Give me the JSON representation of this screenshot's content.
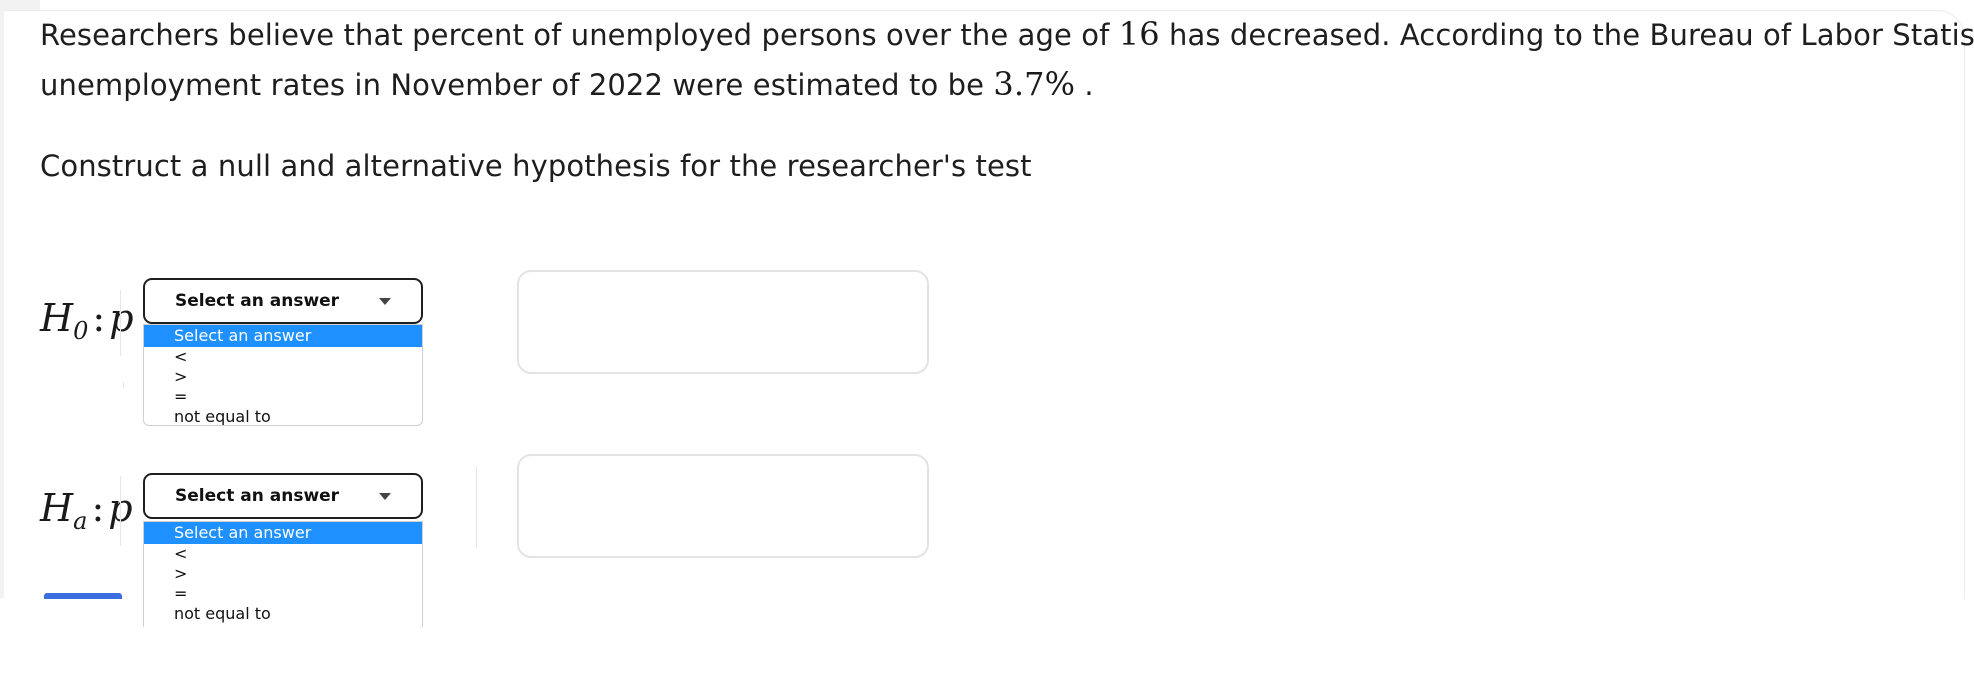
{
  "question": {
    "line1_a": "Researchers believe that percent of unemployed persons over the age of ",
    "line1_age": "16",
    "line1_b": " has decreased. According to the Bureau of Labor Statistics,",
    "line2_a": "unemployment rates in November of 2022 were estimated to be ",
    "line2_rate": "3.7",
    "line2_pct": "%",
    "line2_end": " .",
    "instruction": "Construct a null and alternative hypothesis for the researcher's test"
  },
  "null_hypothesis": {
    "H": "H",
    "sub": "0",
    "colon": ":",
    "p": "p",
    "select_label": "Select an answer",
    "options": [
      "Select an answer",
      "<",
      ">",
      "=",
      "not equal to"
    ],
    "selected_option": "Select an answer",
    "answer_value": ""
  },
  "alt_hypothesis": {
    "H": "H",
    "sub": "a",
    "colon": ":",
    "p": "p",
    "select_label": "Select an answer",
    "options": [
      "Select an answer",
      "<",
      ">",
      "=",
      "not equal to"
    ],
    "selected_option": "Select an answer",
    "answer_value": ""
  },
  "colors": {
    "highlight": "#1e90ff",
    "accent_button": "#3b6fe0"
  }
}
